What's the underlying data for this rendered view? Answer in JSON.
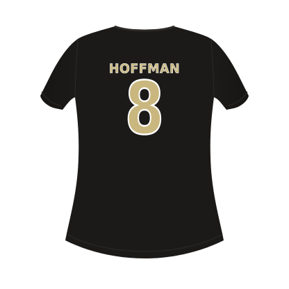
{
  "product": {
    "player_name": "HOFFMAN",
    "player_number": "8"
  },
  "colors": {
    "shirt": "#1c1a18",
    "lettering": "#c9b77f",
    "lettering_outline": "#ffffff",
    "background": "#ffffff"
  }
}
